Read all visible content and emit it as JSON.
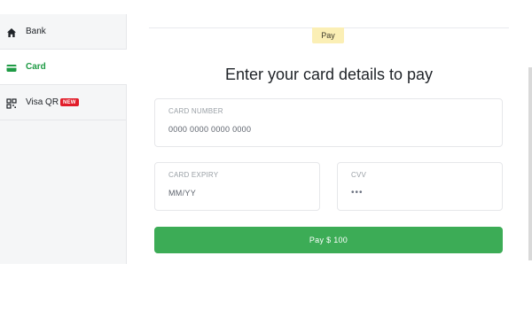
{
  "sidebar": {
    "items": [
      {
        "label": "Bank",
        "icon": "home-icon"
      },
      {
        "label": "Card",
        "icon": "credit-card-icon",
        "active": true
      },
      {
        "label": "Visa QR",
        "icon": "qr-code-icon",
        "badge": "NEW"
      }
    ]
  },
  "main": {
    "tag": "Pay",
    "title": "Enter your card details to pay",
    "fields": {
      "card_number": {
        "label": "CARD NUMBER",
        "value": "0000 0000 0000 0000"
      },
      "card_expiry": {
        "label": "CARD EXPIRY",
        "value": "MM/YY"
      },
      "cvv": {
        "label": "CVV",
        "value": "•••"
      }
    },
    "pay_button": "Pay $ 100"
  },
  "colors": {
    "accent_green": "#3cac56",
    "active_text": "#1f9b45",
    "badge_red": "#e11d2a",
    "tag_yellow": "#fbefb5"
  }
}
